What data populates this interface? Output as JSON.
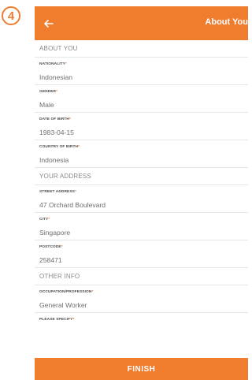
{
  "step_badge": "4",
  "header": {
    "back_icon": "arrow-left-icon",
    "title": "About You"
  },
  "sections": {
    "about_you": "ABOUT YOU",
    "your_address": "YOUR ADDRESS",
    "other_info": "OTHER INFO"
  },
  "fields": {
    "nationality": {
      "label": "NATIONALITY",
      "value": "Indonesian"
    },
    "gender": {
      "label": "GENDER",
      "value": "Male"
    },
    "date_of_birth": {
      "label": "DATE OF BIRTH",
      "value": "1983-04-15"
    },
    "country_of_birth": {
      "label": "COUNTRY OF BIRTH",
      "value": "Indonesia"
    },
    "street_address": {
      "label": "STREET ADDRESS",
      "value": "47 Orchard Boulevard"
    },
    "city": {
      "label": "CITY",
      "value": "Singapore"
    },
    "postcode": {
      "label": "POSTCODE",
      "value": "258471"
    },
    "occupation": {
      "label": "OCCUPATION/PROFESSION",
      "value": "General Worker"
    },
    "please_specify": {
      "label": "PLEASE SPECIFY",
      "value": ""
    }
  },
  "required_marker": "*",
  "finish_label": "FINISH",
  "colors": {
    "accent": "#f07c2e",
    "text": "#6f6f6f"
  }
}
